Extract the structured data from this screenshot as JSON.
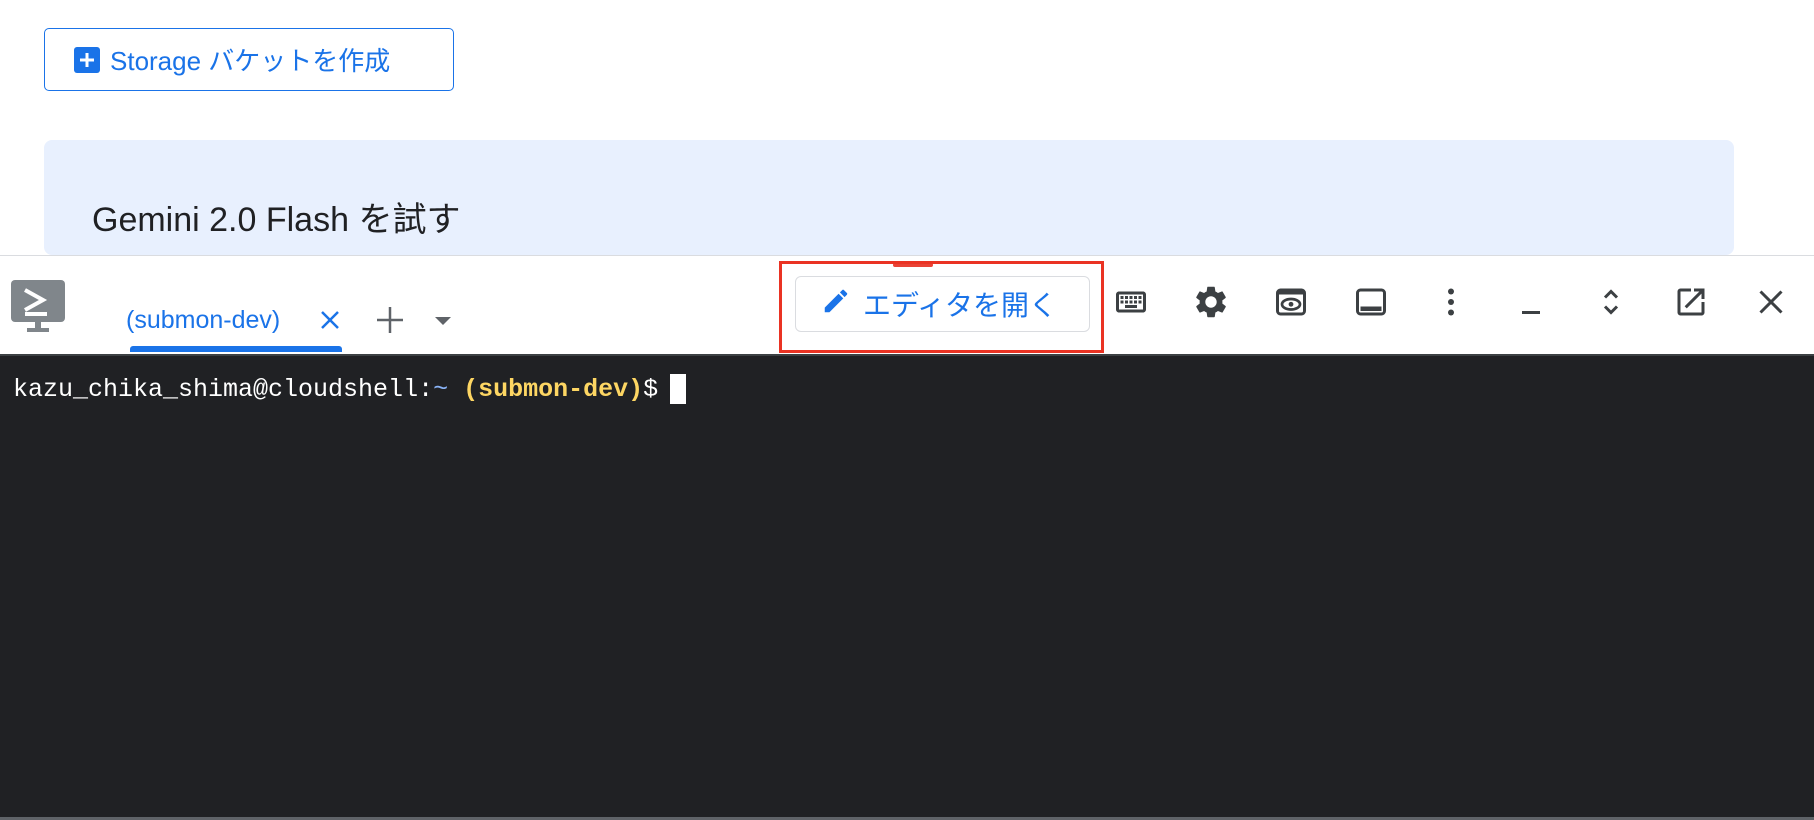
{
  "console": {
    "create_bucket_label": "Storage バケットを作成",
    "gemini_title": "Gemini 2.0 Flash を試す"
  },
  "shell": {
    "tab_label": "(submon-dev)",
    "open_editor_label": "エディタを開く",
    "toolbar_icons": [
      "keyboard-icon",
      "settings-icon",
      "web-preview-icon",
      "dock-panel-icon",
      "more-vert-icon",
      "minimize-icon",
      "expand-icon",
      "open-new-window-icon",
      "close-icon"
    ]
  },
  "terminal": {
    "user_host": "kazu_chika_shima@cloudshell:",
    "path": "~",
    "project": "(submon-dev)",
    "prompt": "$"
  },
  "colors": {
    "accent": "#1a73e8",
    "highlight": "#ea3323",
    "terminal_bg": "#202124",
    "project_yellow": "#fdd663",
    "card_bg": "#e8f0fe"
  }
}
